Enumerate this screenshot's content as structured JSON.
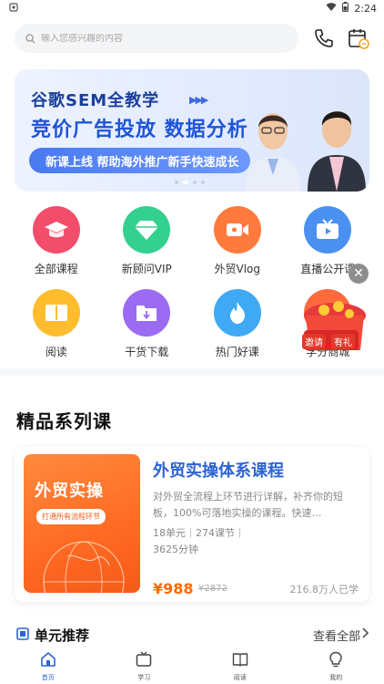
{
  "status_bar": {
    "time": "2:24"
  },
  "search": {
    "placeholder": "输入您感兴趣的内容"
  },
  "banner": {
    "title": "谷歌SEM全教学",
    "subtitle": "竞价广告投放 数据分析",
    "tag": "新课上线 帮助海外推广新手快速成长"
  },
  "categories": [
    {
      "label": "全部课程",
      "icon": "graduation-cap-icon",
      "color": "#f24d6b"
    },
    {
      "label": "新顾问VIP",
      "icon": "diamond-icon",
      "color": "#34d08f"
    },
    {
      "label": "外贸Vlog",
      "icon": "video-camera-icon",
      "color": "#ff7a3c"
    },
    {
      "label": "直播公开课",
      "icon": "tv-icon",
      "color": "#4a90f0"
    },
    {
      "label": "阅读",
      "icon": "book-icon",
      "color": "#ffbd2e"
    },
    {
      "label": "干货下载",
      "icon": "download-folder-icon",
      "color": "#9b6cf2"
    },
    {
      "label": "热门好课",
      "icon": "flame-icon",
      "color": "#3fa9f5"
    },
    {
      "label": "学分商城",
      "icon": "gift-icon",
      "color": "#ff6a3c"
    }
  ],
  "promo": {
    "text_left": "邀请",
    "text_right": "有礼"
  },
  "section": {
    "title": "精品系列课"
  },
  "course": {
    "cover_title": "外贸实操",
    "cover_tagline": "打通所有流程环节",
    "title": "外贸实操体系课程",
    "description": "对外贸全流程上环节进行详解，补齐你的短板，100%可落地实操的课程。快速…",
    "meta_units": "18单元｜274课节｜",
    "meta_duration": "3625分钟",
    "price": "¥988",
    "old_price": "¥2872",
    "learners": "216.8万人已学"
  },
  "unit_section": {
    "title": "单元推荐",
    "view_all": "查看全部"
  },
  "bottom_nav": [
    {
      "label": "首页",
      "icon": "home-icon",
      "active": true
    },
    {
      "label": "学习",
      "icon": "tv-icon",
      "active": false
    },
    {
      "label": "阅读",
      "icon": "book-icon",
      "active": false
    },
    {
      "label": "我的",
      "icon": "lightbulb-icon",
      "active": false
    }
  ],
  "colors": {
    "accent": "#2d63d6",
    "price": "#ff6a00"
  }
}
